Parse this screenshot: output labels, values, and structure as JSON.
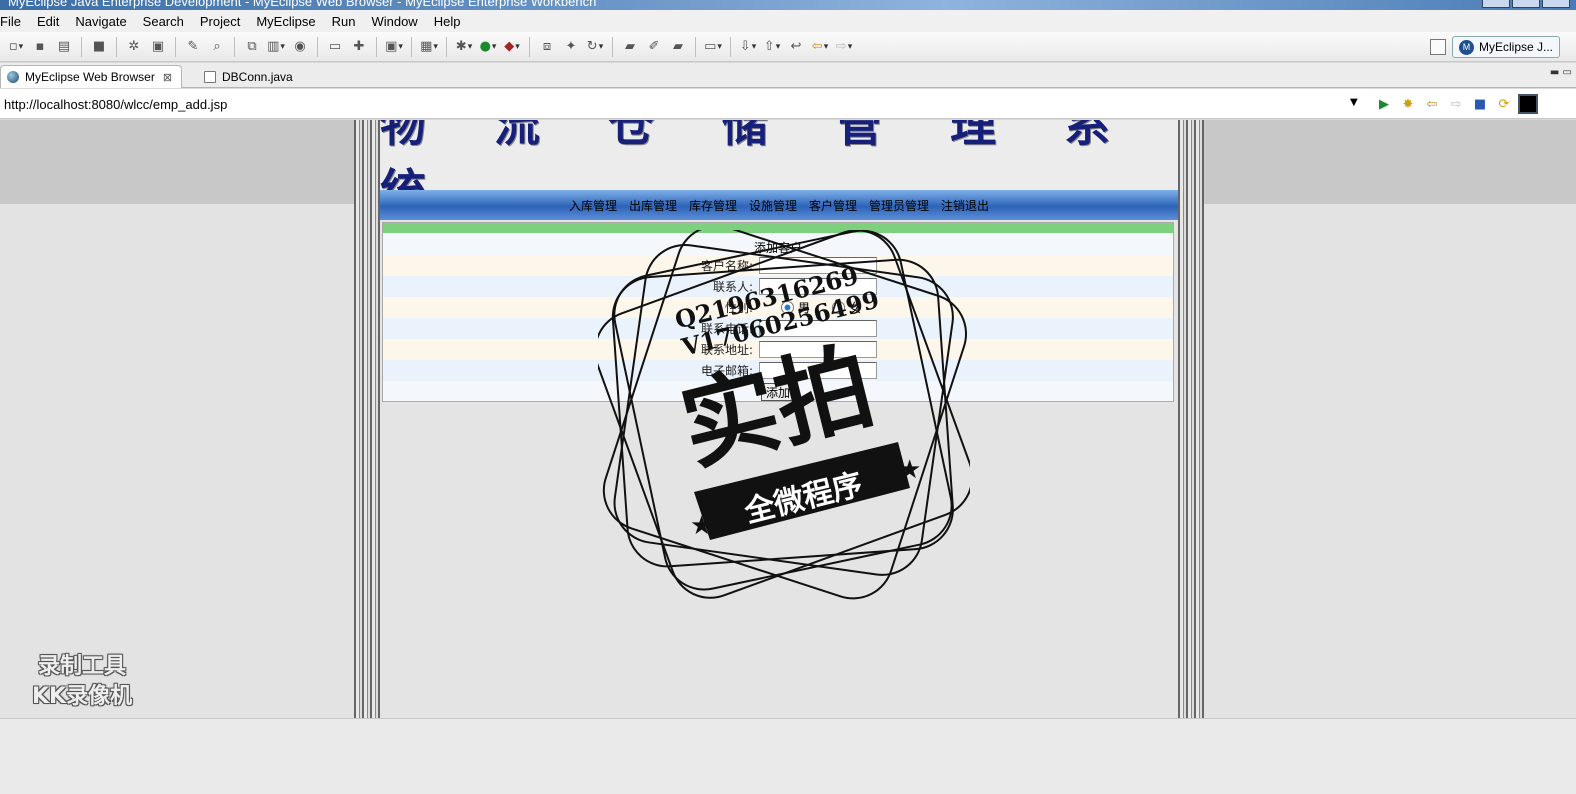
{
  "window": {
    "title": "MyEclipse Java Enterprise Development - MyEclipse Web Browser - MyEclipse Enterprise Workbench"
  },
  "menu": [
    "File",
    "Edit",
    "Navigate",
    "Search",
    "Project",
    "MyEclipse",
    "Run",
    "Window",
    "Help"
  ],
  "perspective": {
    "label": "MyEclipse J...",
    "logo": "M"
  },
  "tabs": [
    {
      "label": "MyEclipse Web Browser",
      "active": true,
      "icon": "globe-icon"
    },
    {
      "label": "DBConn.java",
      "active": false,
      "icon": "java-file-icon"
    }
  ],
  "browser": {
    "url": "http://localhost:8080/wlcc/emp_add.jsp"
  },
  "page": {
    "title": "物 流 仓 储 管 理 系 统",
    "nav": [
      "入库管理",
      "出库管理",
      "库存管理",
      "设施管理",
      "客户管理",
      "管理员管理",
      "注销退出"
    ],
    "form": {
      "title": "添加客户",
      "fields": [
        {
          "label": "客户名称:"
        },
        {
          "label": "联系人:"
        },
        {
          "label": "性别:",
          "options": [
            "男",
            "女"
          ],
          "selected": "男"
        },
        {
          "label": "联系电话:"
        },
        {
          "label": "联系地址:"
        },
        {
          "label": "电子邮箱:"
        }
      ],
      "submit": "添加"
    }
  },
  "watermark": {
    "contact_line1": "Q2196316269",
    "contact_line2": "V17060256499",
    "stamp_main": "实拍",
    "stamp_banner": "全微程序",
    "recorder_line1": "录制工具",
    "recorder_line2": "KK录像机"
  },
  "colors": {
    "title_blue": "#16207a",
    "nav_blue": "#2d63b8",
    "form_green": "#7dd07d"
  }
}
